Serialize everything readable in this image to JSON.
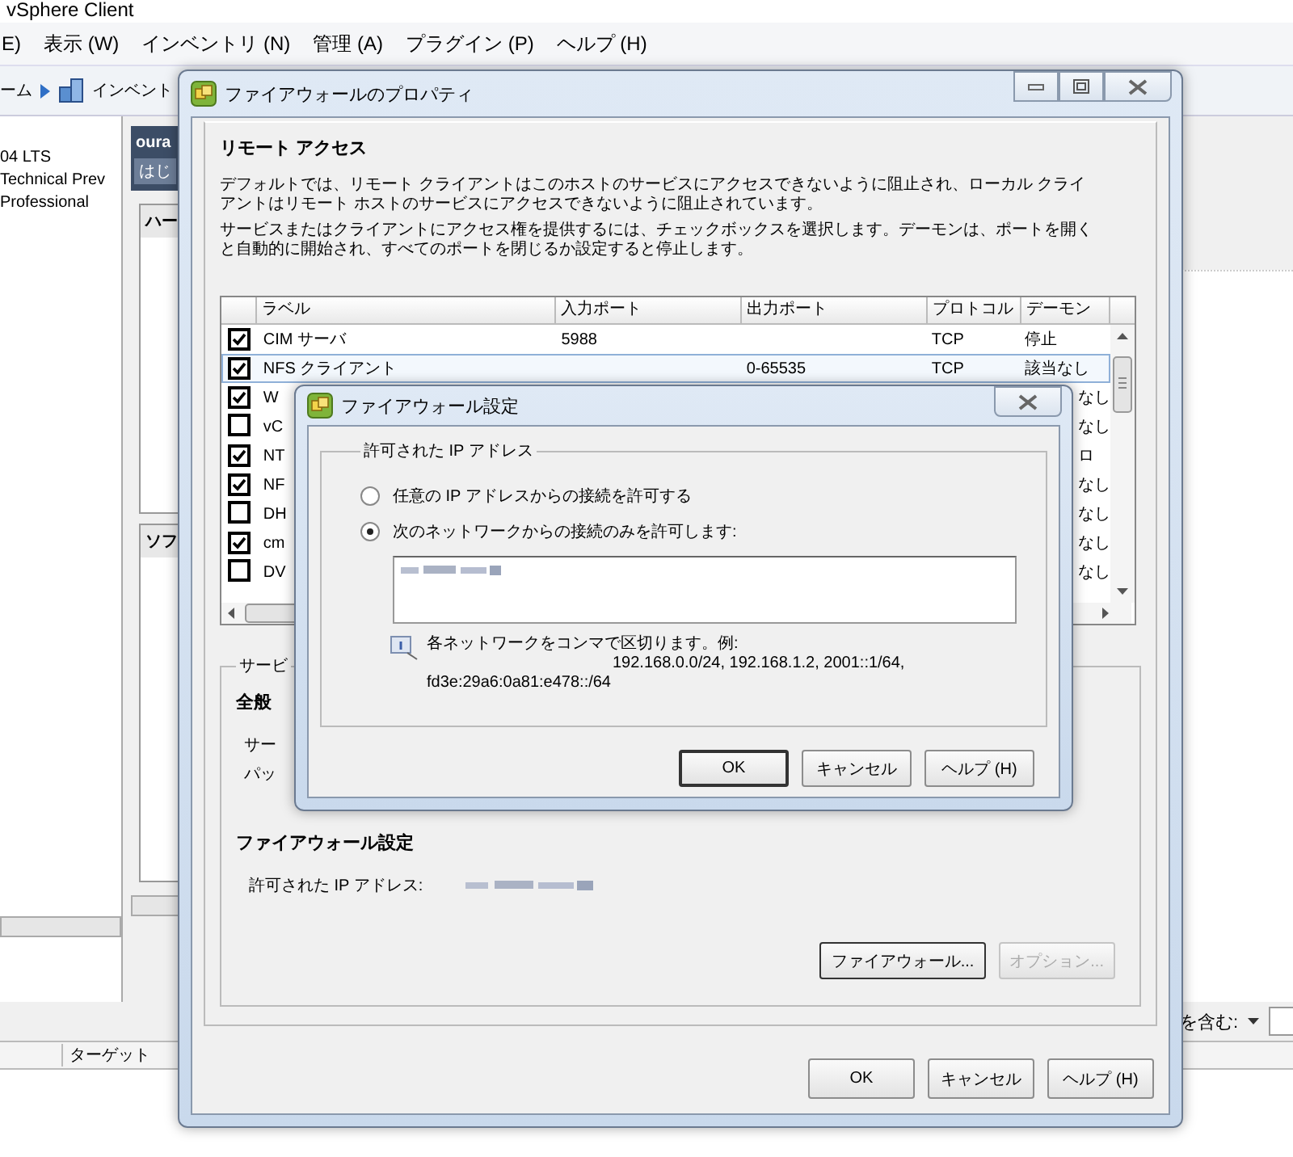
{
  "app": {
    "title": "vSphere Client",
    "menu": [
      "E)",
      "表示 (W)",
      "インベントリ (N)",
      "管理 (A)",
      "プラグイン (P)",
      "ヘルプ (H)"
    ],
    "toolbar": [
      "ーム",
      "インベント"
    ],
    "left_list": [
      "04 LTS",
      "Technical Prev",
      "Professional"
    ],
    "host_header": "oura",
    "tab_fragment": "はじ",
    "section_fragments": [
      "ハー",
      "ソフ"
    ],
    "filter_label": "を含む:",
    "bottom_column": "ターゲット"
  },
  "dialog": {
    "title": "ファイアウォールのプロパティ",
    "heading": "リモート アクセス",
    "paragraphs": [
      "デフォルトでは、リモート クライアントはこのホストのサービスにアクセスできないように阻止され、ローカル クライアントはリモート ホストのサービスにアクセスできないように阻止されています。",
      "サービスまたはクライアントにアクセス権を提供するには、チェックボックスを選択します。デーモンは、ポートを開くと自動的に開始され、すべてのポートを閉じるか設定すると停止します。"
    ],
    "table": {
      "columns": [
        "ラベル",
        "入力ポート",
        "出力ポート",
        "プロトコル",
        "デーモン"
      ],
      "rows": [
        {
          "checked": true,
          "selected": false,
          "label": "CIM サーバ",
          "in_port": "5988",
          "protocol": "TCP",
          "daemon": "停止"
        },
        {
          "checked": true,
          "selected": true,
          "label": "NFS クライアント",
          "out_port": "0-65535",
          "protocol": "TCP",
          "daemon": "該当なし"
        },
        {
          "checked": true,
          "selected": false,
          "label": "W",
          "daemon": "なし"
        },
        {
          "checked": false,
          "selected": false,
          "label": "vC",
          "daemon": "なし"
        },
        {
          "checked": true,
          "selected": false,
          "label": "NT",
          "daemon": "ロ"
        },
        {
          "checked": true,
          "selected": false,
          "label": "NF",
          "daemon": "なし"
        },
        {
          "checked": false,
          "selected": false,
          "label": "DH",
          "daemon": "なし"
        },
        {
          "checked": true,
          "selected": false,
          "label": "cm",
          "daemon": "なし"
        },
        {
          "checked": false,
          "selected": false,
          "label": "DV",
          "daemon": "なし"
        }
      ]
    },
    "services": {
      "legend": "サービ",
      "general_heading": "全般",
      "general_fields": [
        "サー",
        "パッ"
      ],
      "firewall_heading": "ファイアウォール設定",
      "allowed_ip_label": "許可された IP アドレス:",
      "buttons": [
        {
          "label": "ファイアウォール...",
          "disabled": false
        },
        {
          "label": "オプション...",
          "disabled": true
        }
      ]
    },
    "buttons": [
      "OK",
      "キャンセル",
      "ヘルプ (H)"
    ]
  },
  "firewall_dialog": {
    "title": "ファイアウォール設定",
    "group": "許可された IP アドレス",
    "options": [
      {
        "label": "任意の IP アドレスからの接続を許可する",
        "selected": false
      },
      {
        "label": "次のネットワークからの接続のみを許可します:",
        "selected": true
      }
    ],
    "hint_lines": [
      "各ネットワークをコンマで区切ります。例:",
      "192.168.0.0/24, 192.168.1.2, 2001::1/64,",
      "fd3e:29a6:0a81:e478::/64"
    ],
    "buttons": [
      {
        "label": "OK",
        "default": true
      },
      {
        "label": "キャンセル",
        "default": false
      },
      {
        "label": "ヘルプ (H)",
        "default": false
      }
    ]
  }
}
